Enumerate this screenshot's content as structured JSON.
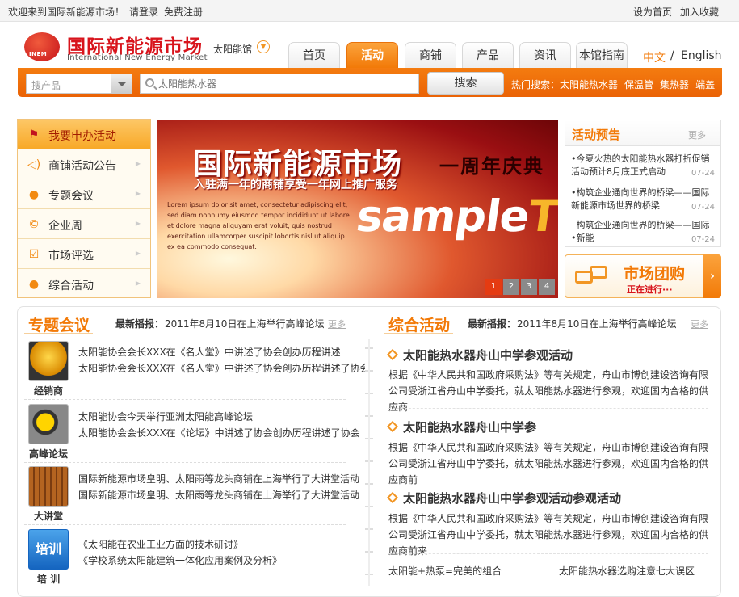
{
  "topbar": {
    "welcome": "欢迎来到国际新能源市场！",
    "login": "请登录",
    "register": "免费注册",
    "homepage": "设为首页",
    "favorite": "加入收藏"
  },
  "header": {
    "logo_cn": "国际新能源市场",
    "logo_en": "International New Energy Market",
    "logo_badge": "INEM",
    "hall": "太阳能馆"
  },
  "nav": {
    "tabs": [
      "首页",
      "活动",
      "商铺",
      "产品",
      "资讯",
      "本馆指南"
    ],
    "active": "活动"
  },
  "lang": {
    "cn": "中文",
    "sep": "/",
    "en": "English"
  },
  "search": {
    "category": "搜产品",
    "placeholder": "太阳能热水器",
    "button": "搜索",
    "hot_label": "热门搜索：",
    "hot": [
      "太阳能热水器",
      "保温管",
      "集热器",
      "端盖"
    ]
  },
  "menu": [
    {
      "label": "我要申办活动",
      "icon": "flag-icon"
    },
    {
      "label": "商铺活动公告",
      "icon": "speaker-icon"
    },
    {
      "label": "专题会议",
      "icon": "person-icon"
    },
    {
      "label": "企业周",
      "icon": "copyright-icon"
    },
    {
      "label": "市场评选",
      "icon": "checkbox-icon"
    },
    {
      "label": "综合活动",
      "icon": "chat-bubble-icon"
    }
  ],
  "banner": {
    "title": "国际新能源市场",
    "anniversary": "一周年庆典",
    "subtitle": "入驻满一年的商铺享受一年网上推广服务",
    "small_text": "Lorem ipsum dolor sit amet, consectetur adipiscing elit, sed diam nonnumy eiusmod tempor incididunt ut labore et dolore magna aliquyam erat voluit, quis nostrud exercitation ullamcorper suscipit lobortis nisl ut aliquip ex ea commodo consequat.",
    "sample_a": "sample",
    "sample_b": "TEXT",
    "pages": [
      "1",
      "2",
      "3",
      "4"
    ],
    "active_page": "1"
  },
  "preview": {
    "title": "活动预告",
    "more": "更多",
    "items": [
      {
        "text": "今夏火热的太阳能热水器打折促销活动预计8月底正式启动",
        "date": "07-24"
      },
      {
        "text": "构筑企业通向世界的桥梁——国际新能源市场世界的桥梁",
        "date": "07-24"
      },
      {
        "text": "构筑企业通向世界的桥梁——国际新能",
        "date": "07-24"
      }
    ]
  },
  "groupbuy": {
    "title": "市场团购",
    "sub": "正在进行···"
  },
  "conferences": {
    "title": "专题会议",
    "news_label": "最新播报：",
    "news": "2011年8月10日在上海举行高峰论坛",
    "more": "更多",
    "rows": [
      {
        "caption": "经销商",
        "lines": [
          "太阳能协会会长XXX在《名人堂》中讲述了协会创办历程讲述",
          "太阳能协会会长XXX在《名人堂》中讲述了协会创办历程讲述了协会"
        ]
      },
      {
        "caption": "高峰论坛",
        "lines": [
          "太阳能协会今天举行亚洲太阳能高峰论坛",
          "太阳能协会会长XXX在《论坛》中讲述了协会创办历程讲述了协会"
        ]
      },
      {
        "caption": "大讲堂",
        "lines": [
          "国际新能源市场皇明、太阳雨等龙头商铺在上海举行了大讲堂活动",
          "国际新能源市场皇明、太阳雨等龙头商铺在上海举行了大讲堂活动"
        ]
      },
      {
        "caption": "培  训",
        "icon_text": "培训",
        "lines": [
          "《太阳能在农业工业方面的技术研讨》",
          "《学校系统太阳能建筑一体化应用案例及分析》"
        ]
      }
    ]
  },
  "activities": {
    "title": "综合活动",
    "news_label": "最新播报：",
    "news": "2011年8月10日在上海举行高峰论坛",
    "more": "更多",
    "items": [
      {
        "title": "太阳能热水器舟山中学参观活动",
        "body": "根据《中华人民共和国政府采购法》等有关规定，舟山市博创建设咨询有限公司受浙江省舟山中学委托，就太阳能热水器进行参观，欢迎国内合格的供应商"
      },
      {
        "title": "太阳能热水器舟山中学参",
        "body": "根据《中华人民共和国政府采购法》等有关规定，舟山市博创建设咨询有限公司受浙江省舟山中学委托，就太阳能热水器进行参观，欢迎国内合格的供应商前"
      },
      {
        "title": "太阳能热水器舟山中学参观活动参观活动",
        "body": "根据《中华人民共和国政府采购法》等有关规定，舟山市博创建设咨询有限公司受浙江省舟山中学委托，就太阳能热水器进行参观，欢迎国内合格的供应商前来"
      }
    ],
    "footer_links": [
      "太阳能+热泵=完美的组合",
      "太阳能热水器选购注意七大误区"
    ]
  },
  "colors": {
    "accent": "#f27a08",
    "brand_red": "#d8141c",
    "menu_bg": "#fffbf1"
  }
}
